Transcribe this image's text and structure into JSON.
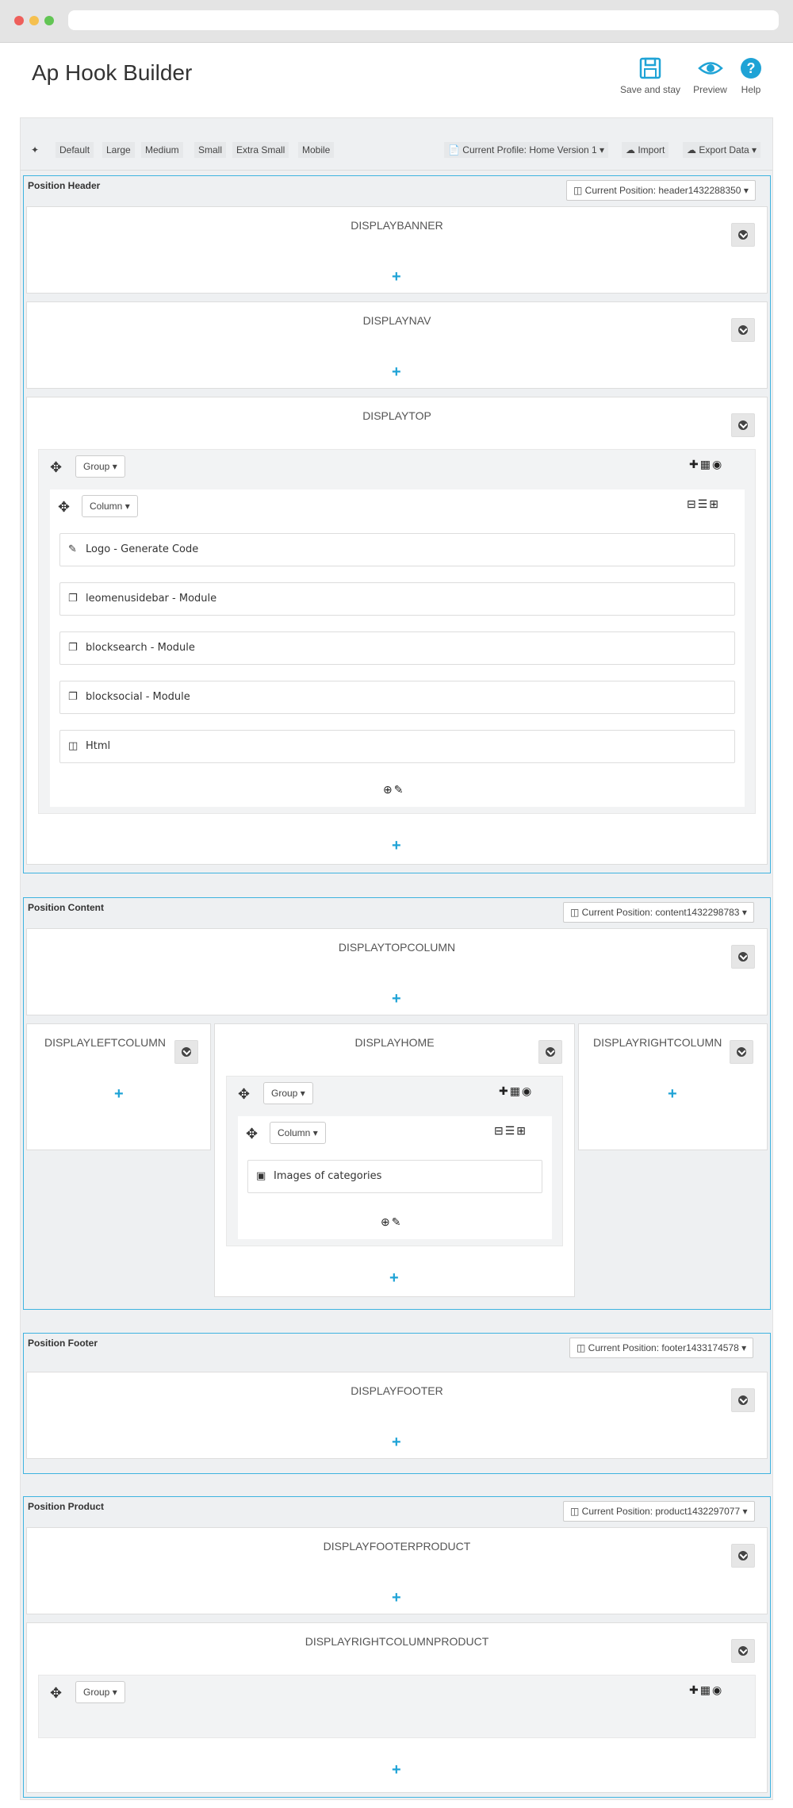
{
  "page": {
    "title": "Ap Hook Builder"
  },
  "toolbar_top": {
    "save": "Save and stay",
    "preview": "Preview",
    "help": "Help"
  },
  "device_bar": {
    "default": "Default",
    "large": "Large",
    "medium": "Medium",
    "small": "Small",
    "extra_small": "Extra Small",
    "mobile": "Mobile",
    "profile": "Current Profile: Home Version 1",
    "import": "Import",
    "export": "Export Data"
  },
  "positions": {
    "header": {
      "title": "Position Header",
      "current": "Current Position: header1432288350",
      "hooks": {
        "banner": "DISPLAYBANNER",
        "nav": "DISPLAYNAV",
        "top": "DISPLAYTOP"
      },
      "group": "Group",
      "column": "Column",
      "widgets": [
        "Logo - Generate Code",
        "leomenusidebar - Module",
        "blocksearch - Module",
        "blocksocial - Module",
        "Html"
      ]
    },
    "content": {
      "title": "Position Content",
      "current": "Current Position: content1432298783",
      "hooks": {
        "topcolumn": "DISPLAYTOPCOLUMN",
        "left": "DISPLAYLEFTCOLUMN",
        "home": "DISPLAYHOME",
        "right": "DISPLAYRIGHTCOLUMN"
      },
      "group": "Group",
      "column": "Column",
      "widgets": [
        "Images of categories"
      ]
    },
    "footer": {
      "title": "Position Footer",
      "current": "Current Position: footer1433174578",
      "hooks": {
        "footer": "DISPLAYFOOTER"
      }
    },
    "product": {
      "title": "Position Product",
      "current": "Current Position: product1432297077",
      "hooks": {
        "footerproduct": "DISPLAYFOOTERPRODUCT",
        "rightproduct": "DISPLAYRIGHTCOLUMNPRODUCT"
      },
      "group": "Group"
    }
  },
  "colors": {
    "accent": "#1fa3d6",
    "border": "#3eb3e0",
    "bg": "#eef0f2"
  }
}
